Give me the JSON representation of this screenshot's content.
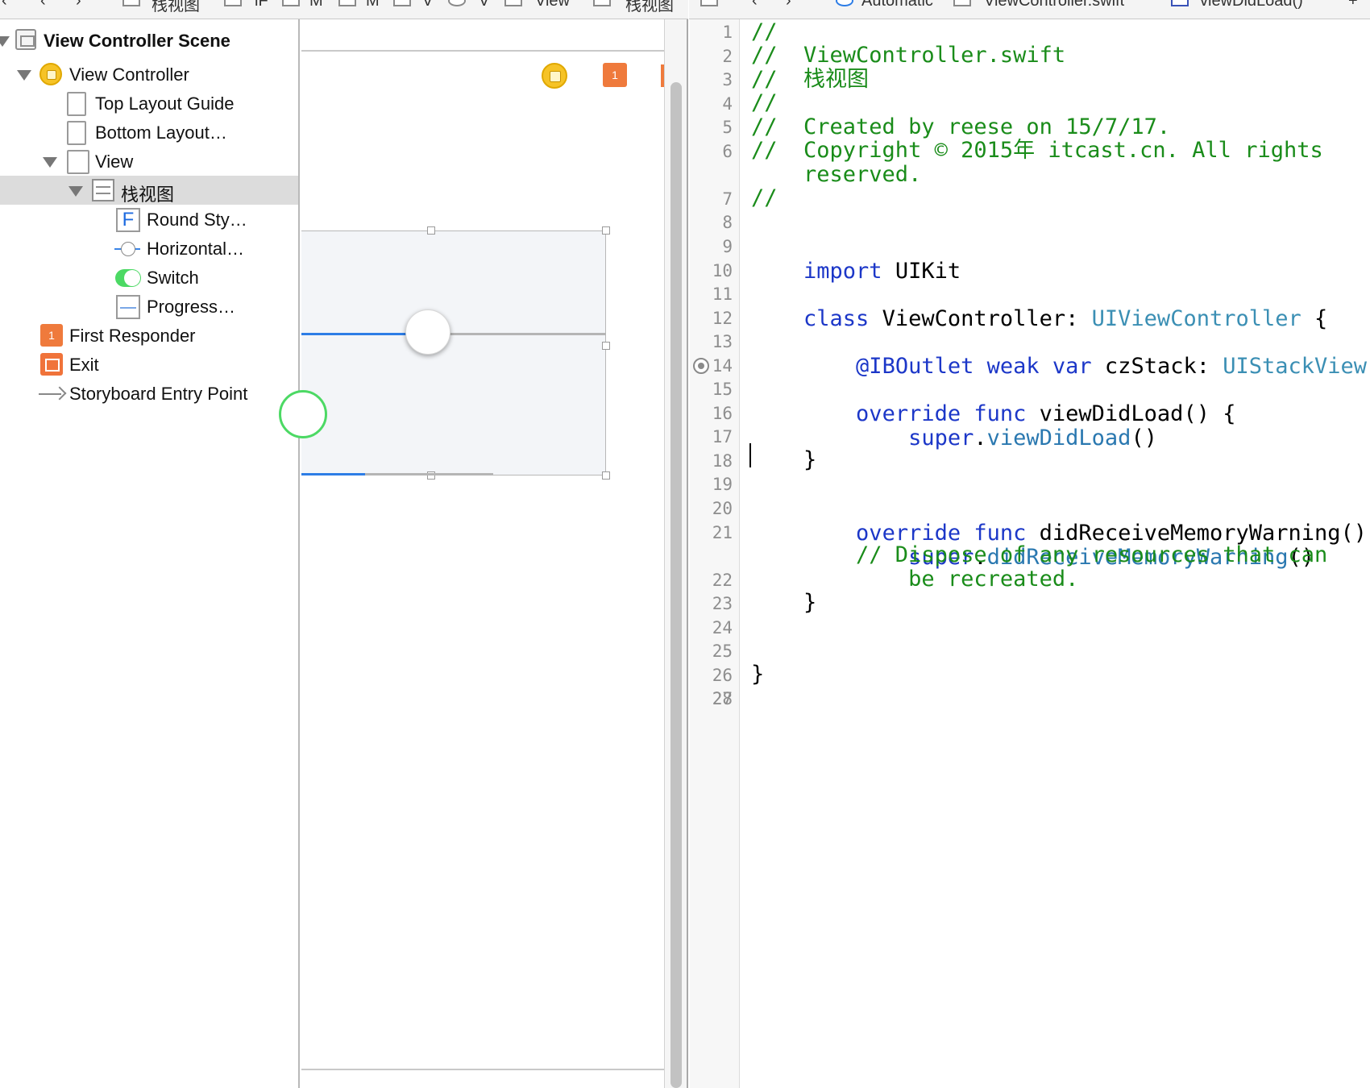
{
  "jumpbar_left": {
    "items": [
      "栈视图",
      "iF",
      "M",
      "M",
      "V",
      "V",
      "View",
      "栈视图"
    ]
  },
  "jumpbar_right": {
    "items": [
      "Automatic",
      "ViewController.swift",
      "viewDidLoad()"
    ]
  },
  "outline": {
    "scene_title": "View Controller Scene",
    "view_controller": "View Controller",
    "top_layout_guide": "Top Layout Guide",
    "bottom_layout_guide": "Bottom Layout…",
    "view": "View",
    "stack_view": "栈视图",
    "text_field": "Round Sty…",
    "slider": "Horizontal…",
    "switch": "Switch",
    "progress": "Progress…",
    "first_responder": "First Responder",
    "exit": "Exit",
    "entry_point": "Storyboard Entry Point"
  },
  "canvas": {
    "slider_value": 0.41,
    "progress_value": 0.33
  },
  "editor": {
    "line_numbers": [
      "1",
      "2",
      "3",
      "4",
      "5",
      "6",
      "7",
      "8",
      "9",
      "10",
      "11",
      "12",
      "13",
      "14",
      "15",
      "16",
      "17",
      "18",
      "19",
      "20",
      "21",
      "22",
      "23",
      "24",
      "25",
      "26",
      "27",
      "28"
    ],
    "lines": {
      "l1": "//",
      "l2": "//  ViewController.swift",
      "l3": "//  栈视图",
      "l4": "//",
      "l5": "//  Created by reese on 15/7/17.",
      "l6a": "//  Copyright © 2015年 itcast.cn. All rights",
      "l6b": "    reserved.",
      "l7": "//",
      "l9_kw": "import",
      "l9_rest": " UIKit",
      "l11_kw": "class",
      "l11_name": " ViewController: ",
      "l11_type": "UIViewController",
      "l11_end": " {",
      "l13_attr": "    @IBOutlet",
      "l13_kw": " weak var",
      "l13_name": " czStack: ",
      "l13_type": "UIStackView",
      "l13_end": "!",
      "l15_kw": "    override func",
      "l15_rest": " viewDidLoad() {",
      "l16_kw": "        super",
      "l16_dot": ".",
      "l16_fn": "viewDidLoad",
      "l16_end": "()",
      "l18": "    }",
      "l20_kw": "    override func",
      "l20_rest": " didReceiveMemoryWarning() {",
      "l21_kw": "        super",
      "l21_dot": ".",
      "l21_fn": "didReceiveMemoryWarning",
      "l21_end": "()",
      "l22a": "        // Dispose of any resources that can",
      "l22b": "            be recreated.",
      "l23": "    }",
      "l26": "}"
    }
  }
}
